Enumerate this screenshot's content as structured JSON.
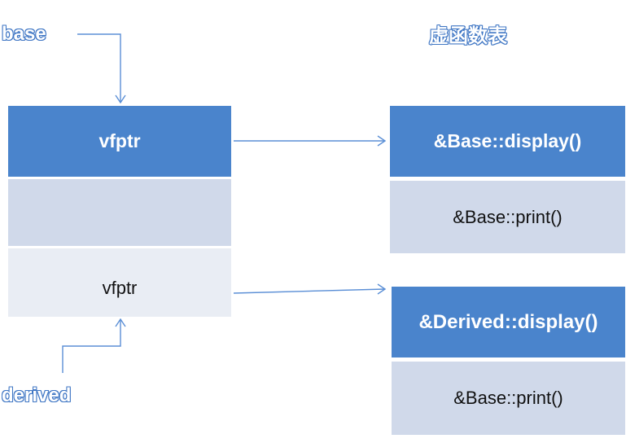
{
  "labels": {
    "base": "base",
    "derived": "derived",
    "table_title": "虚函数表"
  },
  "object": {
    "cells": [
      {
        "text": "vfptr"
      },
      {
        "text": ""
      },
      {
        "text": "vfptr"
      }
    ]
  },
  "vtables": [
    {
      "entries": [
        {
          "text": "&Base::display()"
        },
        {
          "text": "&Base::print()"
        }
      ]
    },
    {
      "entries": [
        {
          "text": "&Derived::display()"
        },
        {
          "text": "&Base::print()"
        }
      ]
    }
  ],
  "colors": {
    "accent": "#4a84cc",
    "arrow": "#5b8fd6",
    "cell_mid": "#d0d9ea",
    "cell_light": "#e9edf4",
    "label_outline": "#3f76c4"
  }
}
